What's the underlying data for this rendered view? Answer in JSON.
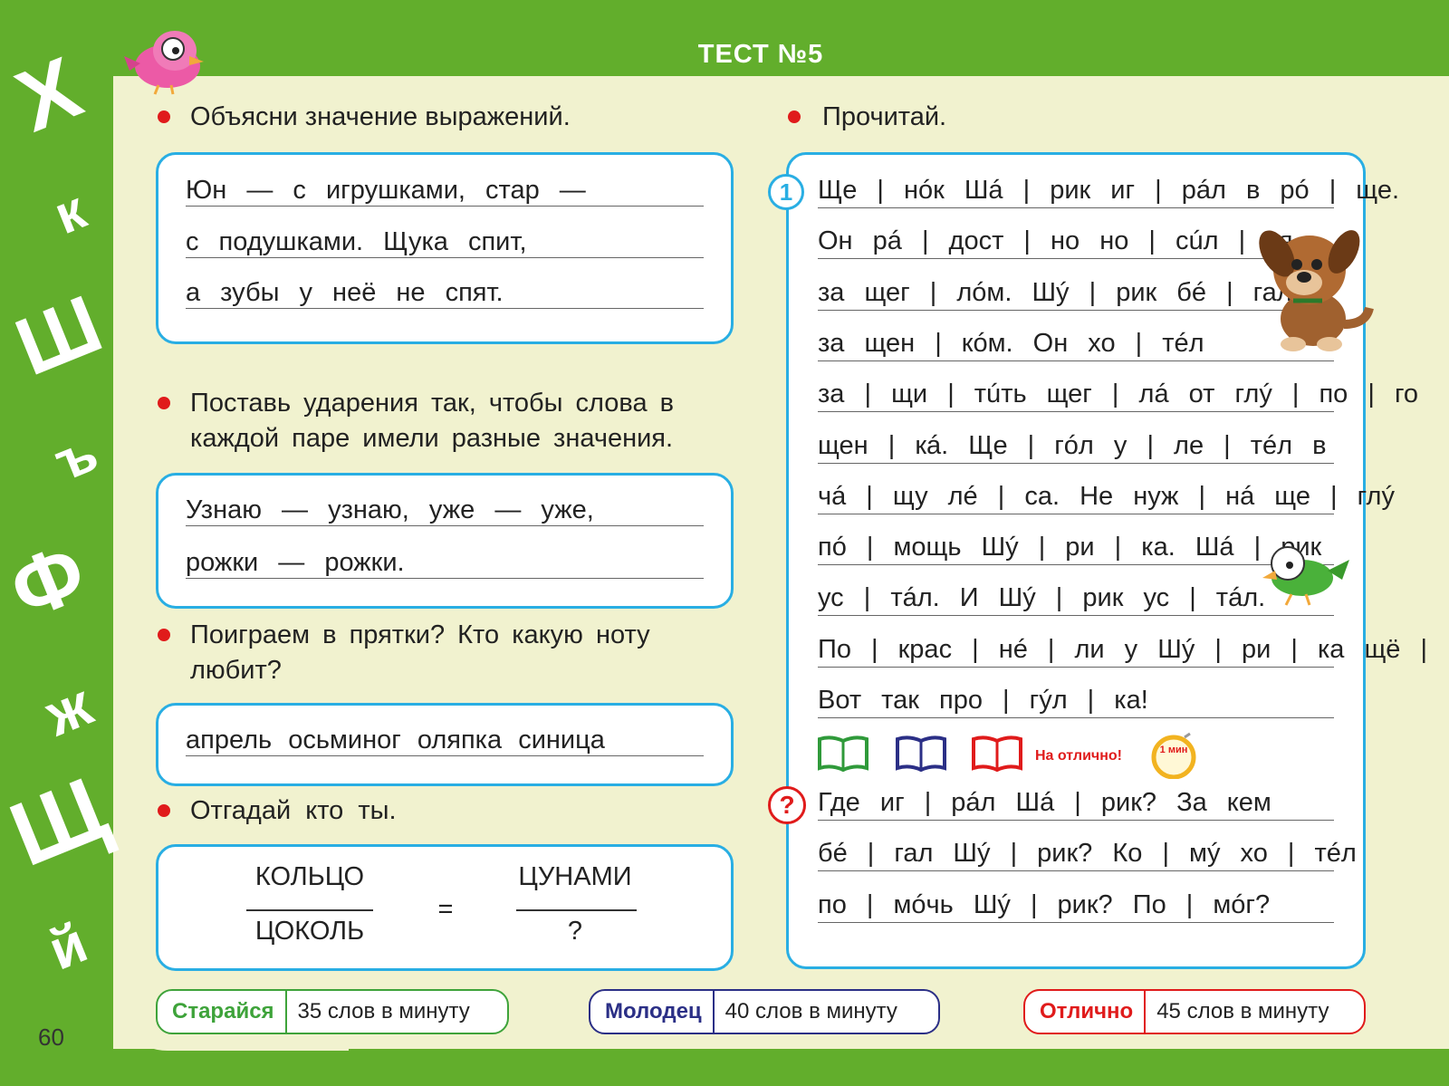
{
  "header": {
    "title": "ТЕСТ №5"
  },
  "side_letters": [
    "Х",
    "к",
    "Ш",
    "ъ",
    "Ф",
    "ж",
    "Щ",
    "й"
  ],
  "page_number": "60",
  "task1": {
    "instruction": "Объясни значение выражений.",
    "lines": [
      "Юн — с игрушками, стар —",
      "с подушками. Щука спит,",
      "а зубы у неё не спят."
    ]
  },
  "task2": {
    "instruction_lines": [
      "Поставь ударения так, чтобы слова в",
      "каждой паре имели разные значения."
    ],
    "lines": [
      "Узнаю — узнаю, уже — уже,",
      "рожки — рожки."
    ]
  },
  "task3": {
    "instruction_lines": [
      "Поиграем в прятки? Кто какую ноту",
      "любит?"
    ],
    "line": "апрель осьминог оляпка синица"
  },
  "task4": {
    "instruction": "Отгадай кто ты.",
    "left_top": "КОЛЬЦО",
    "left_bottom": "ЦОКОЛЬ",
    "equals": "=",
    "right_top": "ЦУНАМИ",
    "right_bottom": "?"
  },
  "reading": {
    "instruction": "Прочитай.",
    "number": "1",
    "lines": [
      "Ще|нóк Шá|рик иг|рáл в рó|ще.",
      "Он рá|дост|но но|сúл|ся",
      "за щег|лóм. Шý|рик бé|гал",
      "за щен|кóм. Он хо|тéл",
      "за|щи|тúть щег|лá от глý|по|го",
      "щен|кá. Ще|гóл у|ле|тéл в",
      "чá|щу лé|са. Не нуж|нá ще|глý",
      "пó|мощь Шý|ри|ка. Шá|рик",
      "ус|тáл. И Шý|рик ус|тáл.",
      "По|крас|нé|ли у Шý|ри|ка щё|ки.",
      "Вот так про|гýл|ка!"
    ],
    "excellent": "На отлично!",
    "timer": "1 мин",
    "question_mark": "?",
    "questions": [
      "Где иг|рáл Шá|рик? За кем",
      "бé|гал Шý|рик? Ко|мý хо|тéл",
      "по|мóчь Шý|рик? По|мóг?"
    ]
  },
  "scores": [
    {
      "label": "Старайся",
      "value": "35 слов в минуту",
      "color": "#3ea33a"
    },
    {
      "label": "Молодец",
      "value": "40 слов в минуту",
      "color": "#2b2f86"
    },
    {
      "label": "Отлично",
      "value": "45 слов в минуту",
      "color": "#e01b1b"
    }
  ],
  "colors": {
    "green": "#62ae2c",
    "blue": "#29aee3",
    "red": "#e01b1b",
    "paper": "#f1f2cf"
  }
}
